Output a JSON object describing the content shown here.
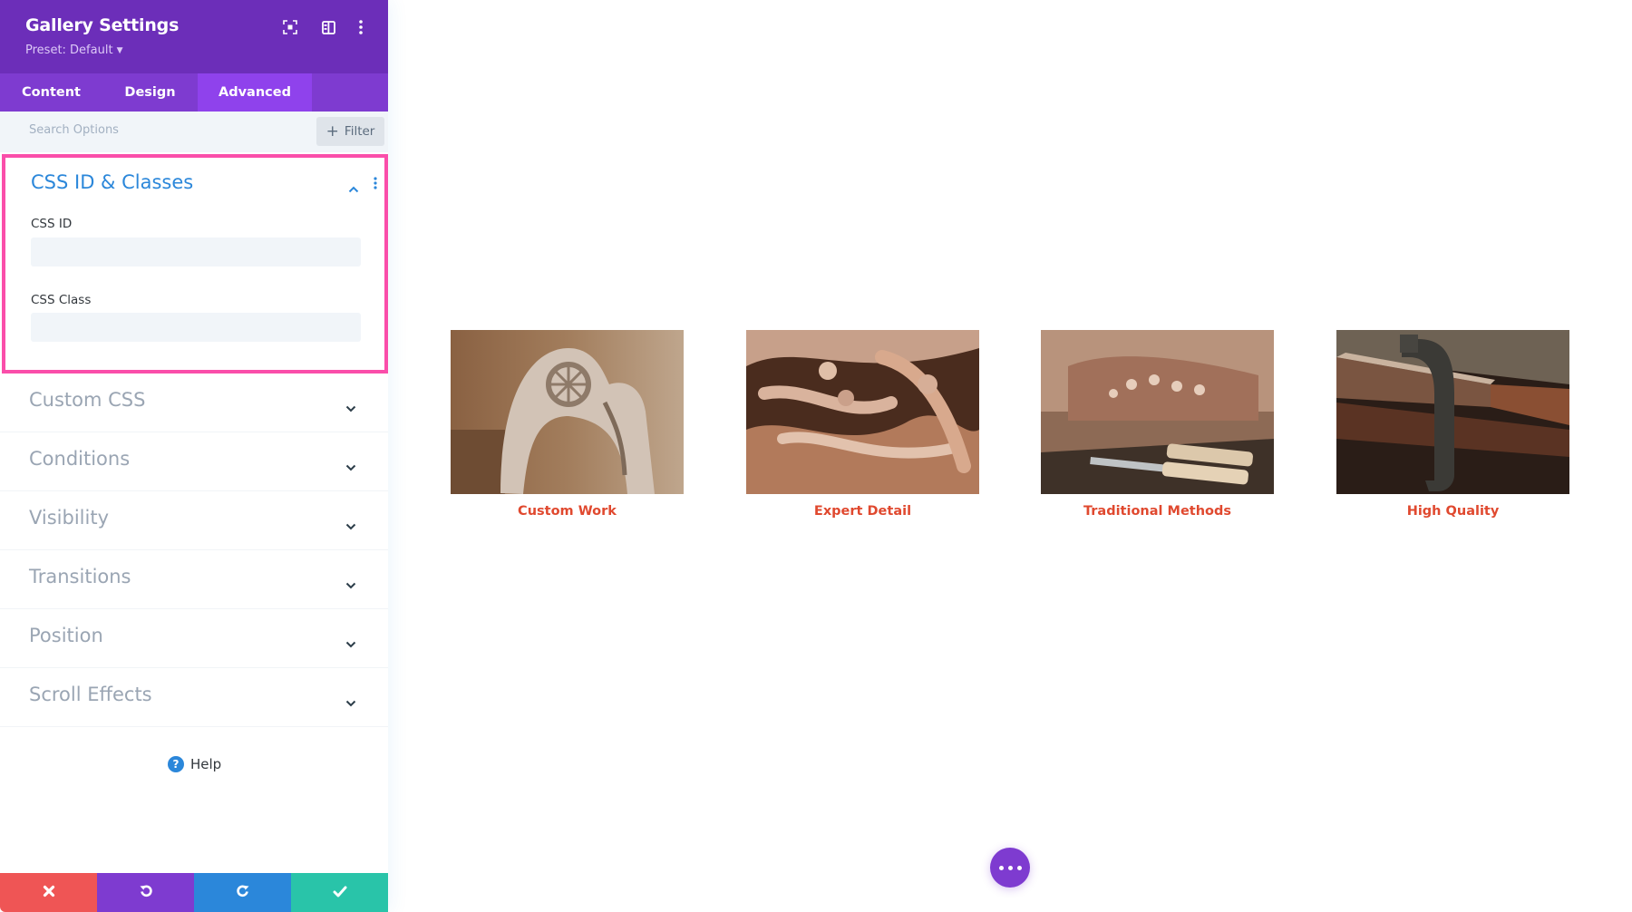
{
  "panel": {
    "title": "Gallery Settings",
    "preset_label": "Preset: Default",
    "header_icons": [
      "focus-mode-icon",
      "split-view-icon",
      "more-options-icon"
    ],
    "tabs": [
      {
        "label": "Content",
        "active": false
      },
      {
        "label": "Design",
        "active": false
      },
      {
        "label": "Advanced",
        "active": true
      }
    ],
    "search": {
      "placeholder": "Search Options",
      "value": ""
    },
    "filter_label": "Filter",
    "open_toggle": {
      "title": "CSS ID & Classes",
      "fields": [
        {
          "label": "CSS ID",
          "value": ""
        },
        {
          "label": "CSS Class",
          "value": ""
        }
      ]
    },
    "collapsed_toggles": [
      {
        "label": "Custom CSS"
      },
      {
        "label": "Conditions"
      },
      {
        "label": "Visibility"
      },
      {
        "label": "Transitions"
      },
      {
        "label": "Position"
      },
      {
        "label": "Scroll Effects"
      }
    ],
    "help_label": "Help",
    "bottom_actions": [
      {
        "name": "cancel",
        "icon": "close-icon",
        "color": "#ef5555"
      },
      {
        "name": "undo",
        "icon": "undo-icon",
        "color": "#7e3bd0"
      },
      {
        "name": "redo",
        "icon": "redo-icon",
        "color": "#2b87da"
      },
      {
        "name": "save",
        "icon": "check-icon",
        "color": "#29c4a9"
      }
    ]
  },
  "gallery": {
    "items": [
      {
        "caption": "Custom Work",
        "image": "carved wooden chair back"
      },
      {
        "caption": "Expert Detail",
        "image": "close-up of wood carving"
      },
      {
        "caption": "Traditional Methods",
        "image": "carving chisels on workbench"
      },
      {
        "caption": "High Quality",
        "image": "clamp on wooden plank"
      }
    ],
    "caption_color": "#e0492f"
  },
  "colors": {
    "header_purple": "#6c2eb9",
    "tab_purple": "#7e3bd0",
    "active_tab": "#8f42ec",
    "highlight_border": "#fa4eaa",
    "accent_blue": "#2b87da"
  },
  "fab": {
    "icon": "more-dots-icon"
  }
}
